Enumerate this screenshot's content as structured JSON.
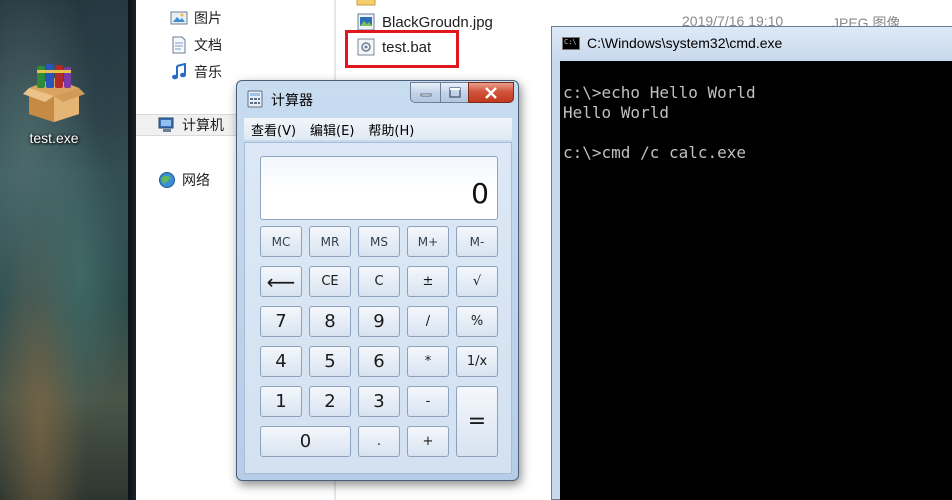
{
  "desktop": {
    "icon_label": "test.exe"
  },
  "explorer": {
    "nav": [
      {
        "label": "图片",
        "icon": "pictures-icon"
      },
      {
        "label": "文档",
        "icon": "documents-icon"
      },
      {
        "label": "音乐",
        "icon": "music-icon"
      },
      {
        "label": "计算机",
        "icon": "computer-icon"
      },
      {
        "label": "网络",
        "icon": "network-icon"
      }
    ],
    "files": [
      {
        "name": "BlackGroudn.jpg",
        "date": "2019/7/16 19:10",
        "type": "JPEG 图像"
      },
      {
        "name": "test.bat"
      }
    ]
  },
  "calculator": {
    "title": "计算器",
    "menu": [
      "查看(V)",
      "编辑(E)",
      "帮助(H)"
    ],
    "display": "0",
    "buttons": {
      "mc": "MC",
      "mr": "MR",
      "ms": "MS",
      "mplus": "M+",
      "mminus": "M-",
      "back": "⟵",
      "ce": "CE",
      "c": "C",
      "plusminus": "±",
      "sqrt": "√",
      "n7": "7",
      "n8": "8",
      "n9": "9",
      "divide": "/",
      "percent": "%",
      "n4": "4",
      "n5": "5",
      "n6": "6",
      "multiply": "*",
      "reciprocal": "1/x",
      "n1": "1",
      "n2": "2",
      "n3": "3",
      "minus": "-",
      "equals": "=",
      "n0": "0",
      "dot": ".",
      "plus": "+"
    }
  },
  "cmd": {
    "title": "C:\\Windows\\system32\\cmd.exe",
    "icon_text": "C:\\",
    "lines": [
      "c:\\>echo Hello World",
      "Hello World",
      "",
      "c:\\>cmd /c calc.exe"
    ]
  },
  "colors": {
    "highlight": "#e0181e",
    "console_bg": "#000000",
    "console_text": "#c0c0c0",
    "close_button": "#c2381e"
  }
}
